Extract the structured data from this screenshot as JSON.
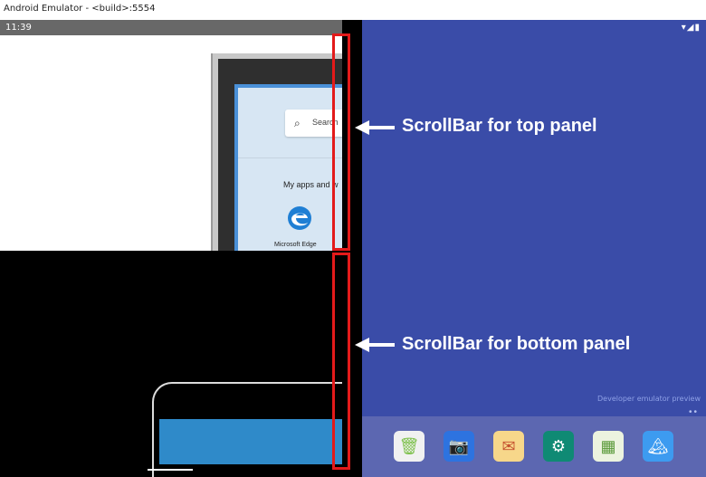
{
  "window": {
    "title": "Android Emulator - <build>:5554"
  },
  "left_device": {
    "status_time": "11:39",
    "search_text": "Search",
    "apps_heading": "My apps and w",
    "edge_label": "Microsoft Edge"
  },
  "right_device": {
    "status_icons": "▾◢▮",
    "developer_note": "Developer emulator preview",
    "page_dots": "••",
    "dock_apps": [
      {
        "name": "Files",
        "glyph": "🗑"
      },
      {
        "name": "Camera",
        "glyph": "📷"
      },
      {
        "name": "Email",
        "glyph": "✉"
      },
      {
        "name": "Settings",
        "glyph": "⚙"
      },
      {
        "name": "Sheets",
        "glyph": "▦"
      },
      {
        "name": "Gallery",
        "glyph": "🏔"
      }
    ]
  },
  "annotations": {
    "top_label": "ScrollBar for top panel",
    "bottom_label": "ScrollBar for bottom panel"
  },
  "colors": {
    "highlight_red": "#e31a1a",
    "right_background": "#3a4ca8",
    "dock": "#5c67b1"
  }
}
